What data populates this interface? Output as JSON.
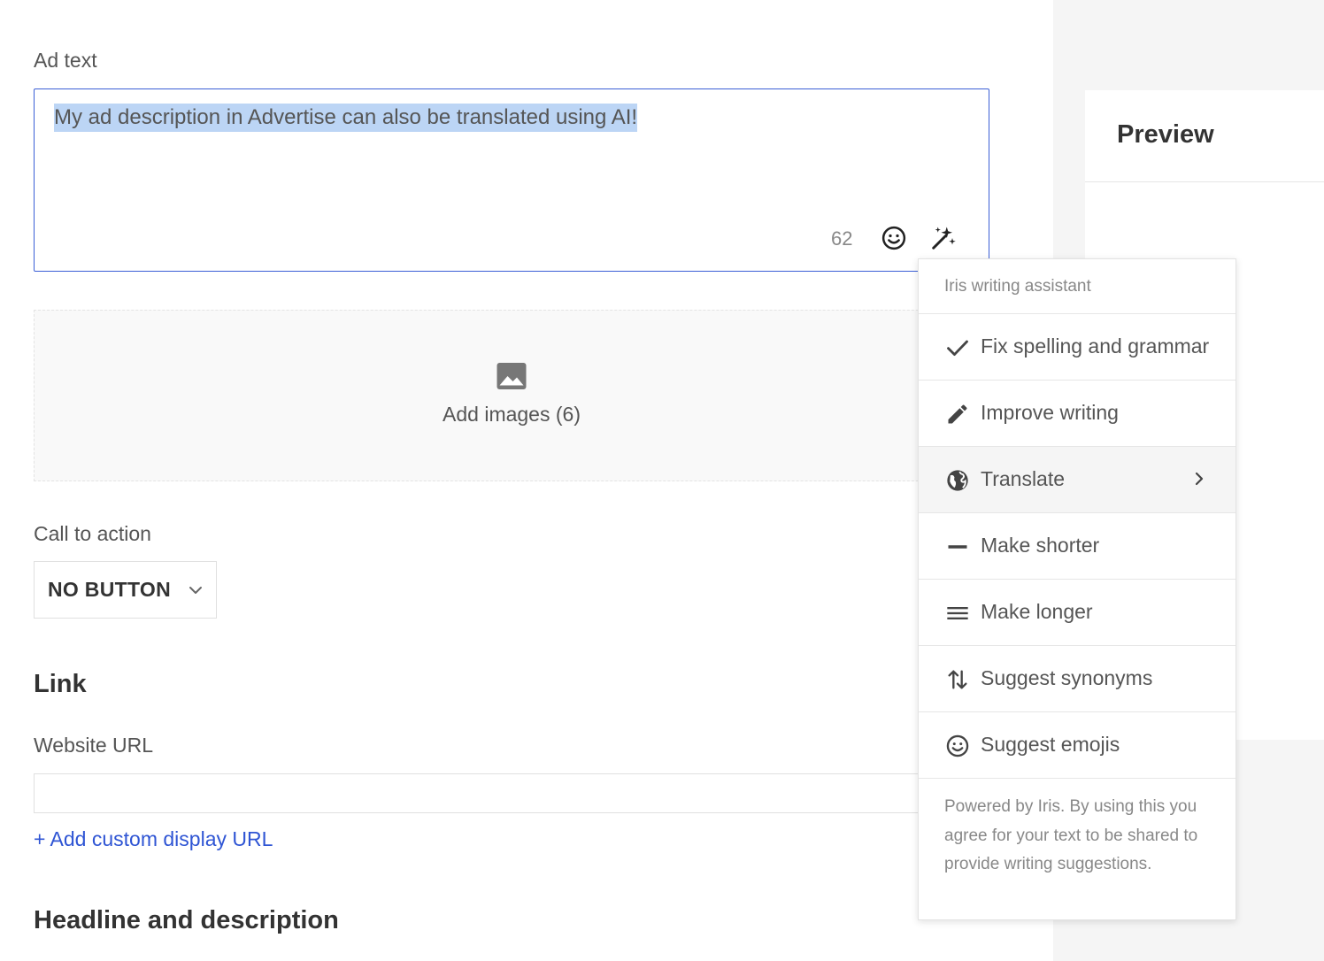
{
  "ad_text": {
    "label": "Ad text",
    "value": "My ad description in Advertise can also be translated using AI!",
    "char_count": "62",
    "emoji_icon": "smiley-icon",
    "ai_icon": "magic-wand-icon"
  },
  "images": {
    "label": "Add images (6)",
    "icon": "image-icon"
  },
  "cta": {
    "label": "Call to action",
    "value": "NO BUTTON",
    "icon": "chevron-down-icon"
  },
  "link": {
    "heading": "Link",
    "url_label": "Website URL",
    "url_value": "",
    "add_custom_url": "+ Add custom display URL"
  },
  "headline": {
    "heading": "Headline and description"
  },
  "preview": {
    "title": "Preview"
  },
  "writing_assistant": {
    "title": "Iris writing assistant",
    "items": [
      {
        "label": "Fix spelling and grammar",
        "icon": "check-icon"
      },
      {
        "label": "Improve writing",
        "icon": "pencil-icon"
      },
      {
        "label": "Translate",
        "icon": "globe-icon",
        "submenu": true,
        "highlighted": true
      },
      {
        "label": "Make shorter",
        "icon": "minus-icon"
      },
      {
        "label": "Make longer",
        "icon": "lines-icon"
      },
      {
        "label": "Suggest synonyms",
        "icon": "swap-arrows-icon"
      },
      {
        "label": "Suggest emojis",
        "icon": "smiley-icon"
      }
    ],
    "footer": "Powered by Iris. By using this you agree for your text to be shared to provide writing suggestions."
  },
  "colors": {
    "accent": "#3b5fd6",
    "link": "#2f55d4",
    "selection": "#bcd5f5",
    "panel_bg": "#f5f5f5"
  }
}
